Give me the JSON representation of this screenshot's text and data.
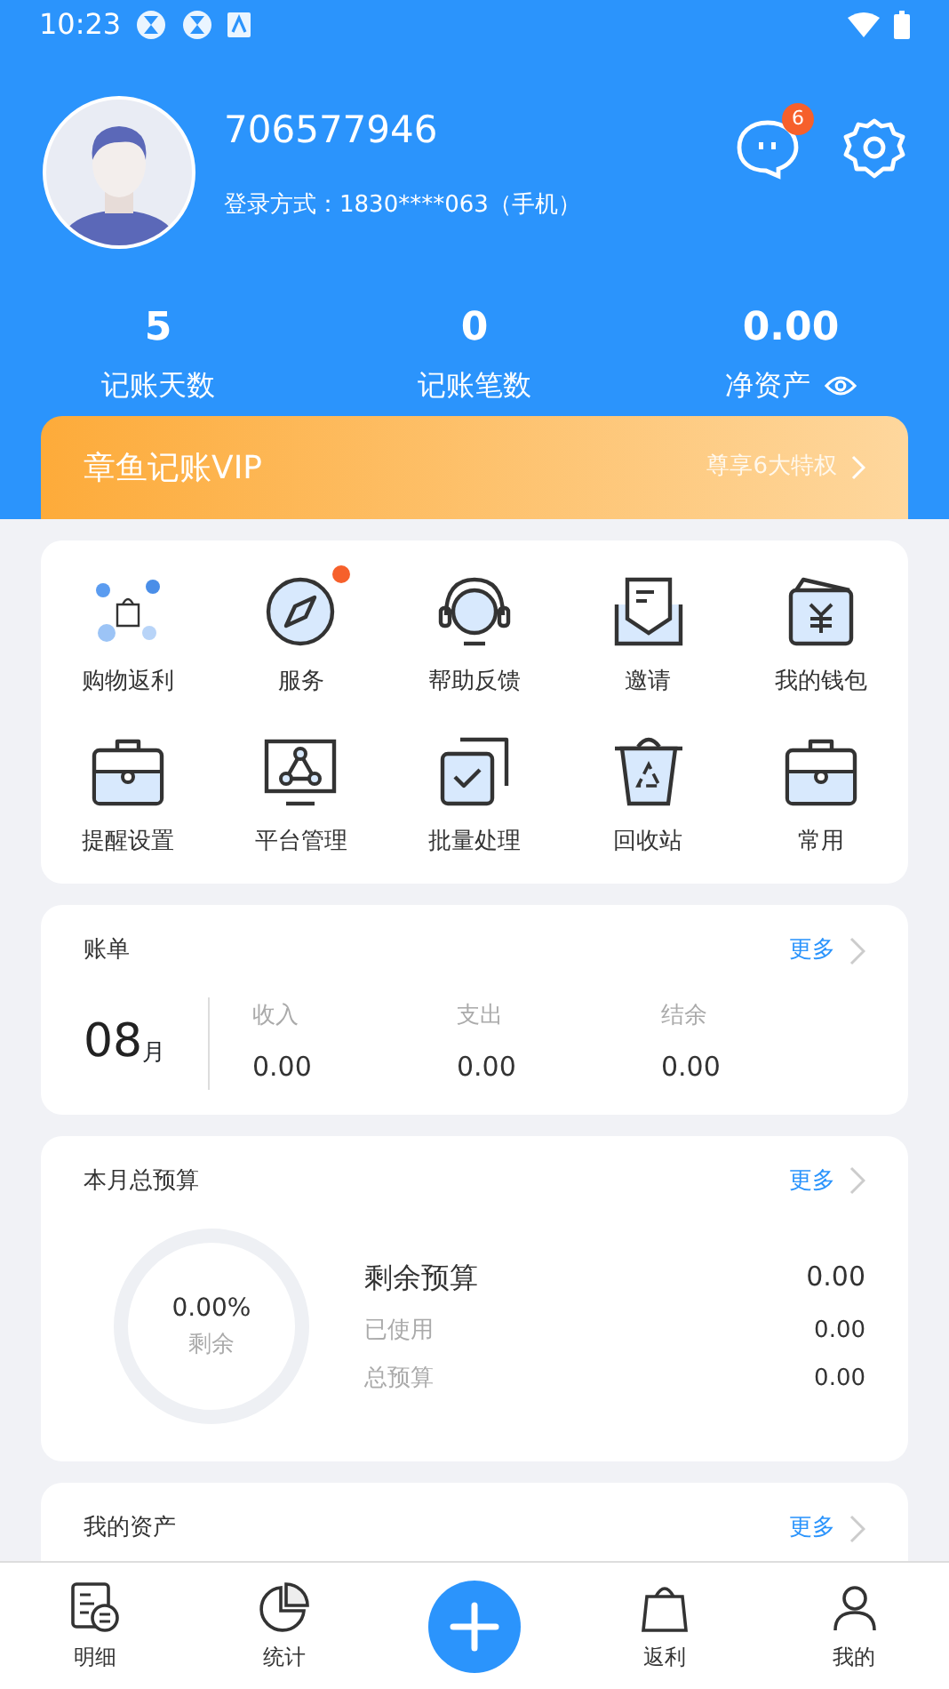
{
  "status_bar": {
    "time": "10:23"
  },
  "profile": {
    "user_id": "706577946",
    "login": "登录方式：1830****063（手机）",
    "message_badge": "6"
  },
  "stats": [
    {
      "value": "5",
      "label": "记账天数",
      "eye": false
    },
    {
      "value": "0",
      "label": "记账笔数",
      "eye": false
    },
    {
      "value": "0.00",
      "label": "净资产",
      "eye": true
    }
  ],
  "vip": {
    "title": "章鱼记账VIP",
    "link": "尊享6大特权"
  },
  "shortcuts": [
    {
      "label": "购物返利",
      "dot": false
    },
    {
      "label": "服务",
      "dot": true
    },
    {
      "label": "帮助反馈",
      "dot": false
    },
    {
      "label": "邀请",
      "dot": false
    },
    {
      "label": "我的钱包",
      "dot": false
    },
    {
      "label": "提醒设置",
      "dot": false
    },
    {
      "label": "平台管理",
      "dot": false
    },
    {
      "label": "批量处理",
      "dot": false
    },
    {
      "label": "回收站",
      "dot": false
    },
    {
      "label": "常用",
      "dot": false
    }
  ],
  "bill": {
    "title": "账单",
    "more": "更多",
    "month": "08",
    "month_unit": "月",
    "columns": [
      {
        "label": "收入",
        "value": "0.00"
      },
      {
        "label": "支出",
        "value": "0.00"
      },
      {
        "label": "结余",
        "value": "0.00"
      }
    ]
  },
  "budget": {
    "title": "本月总预算",
    "more": "更多",
    "percent": "0.00%",
    "percent_label": "剩余",
    "level": 0,
    "rows": [
      {
        "label": "剩余预算",
        "value": "0.00",
        "kind": "main"
      },
      {
        "label": "已使用",
        "value": "0.00",
        "kind": "sub"
      },
      {
        "label": "总预算",
        "value": "0.00",
        "kind": "sub"
      }
    ]
  },
  "assets": {
    "title": "我的资产",
    "more": "更多"
  },
  "tab_bar": [
    {
      "label": "明细",
      "kind": "tab"
    },
    {
      "label": "统计",
      "kind": "tab"
    },
    {
      "kind": "add"
    },
    {
      "label": "返利",
      "kind": "tab"
    },
    {
      "label": "我的",
      "kind": "tab"
    }
  ]
}
